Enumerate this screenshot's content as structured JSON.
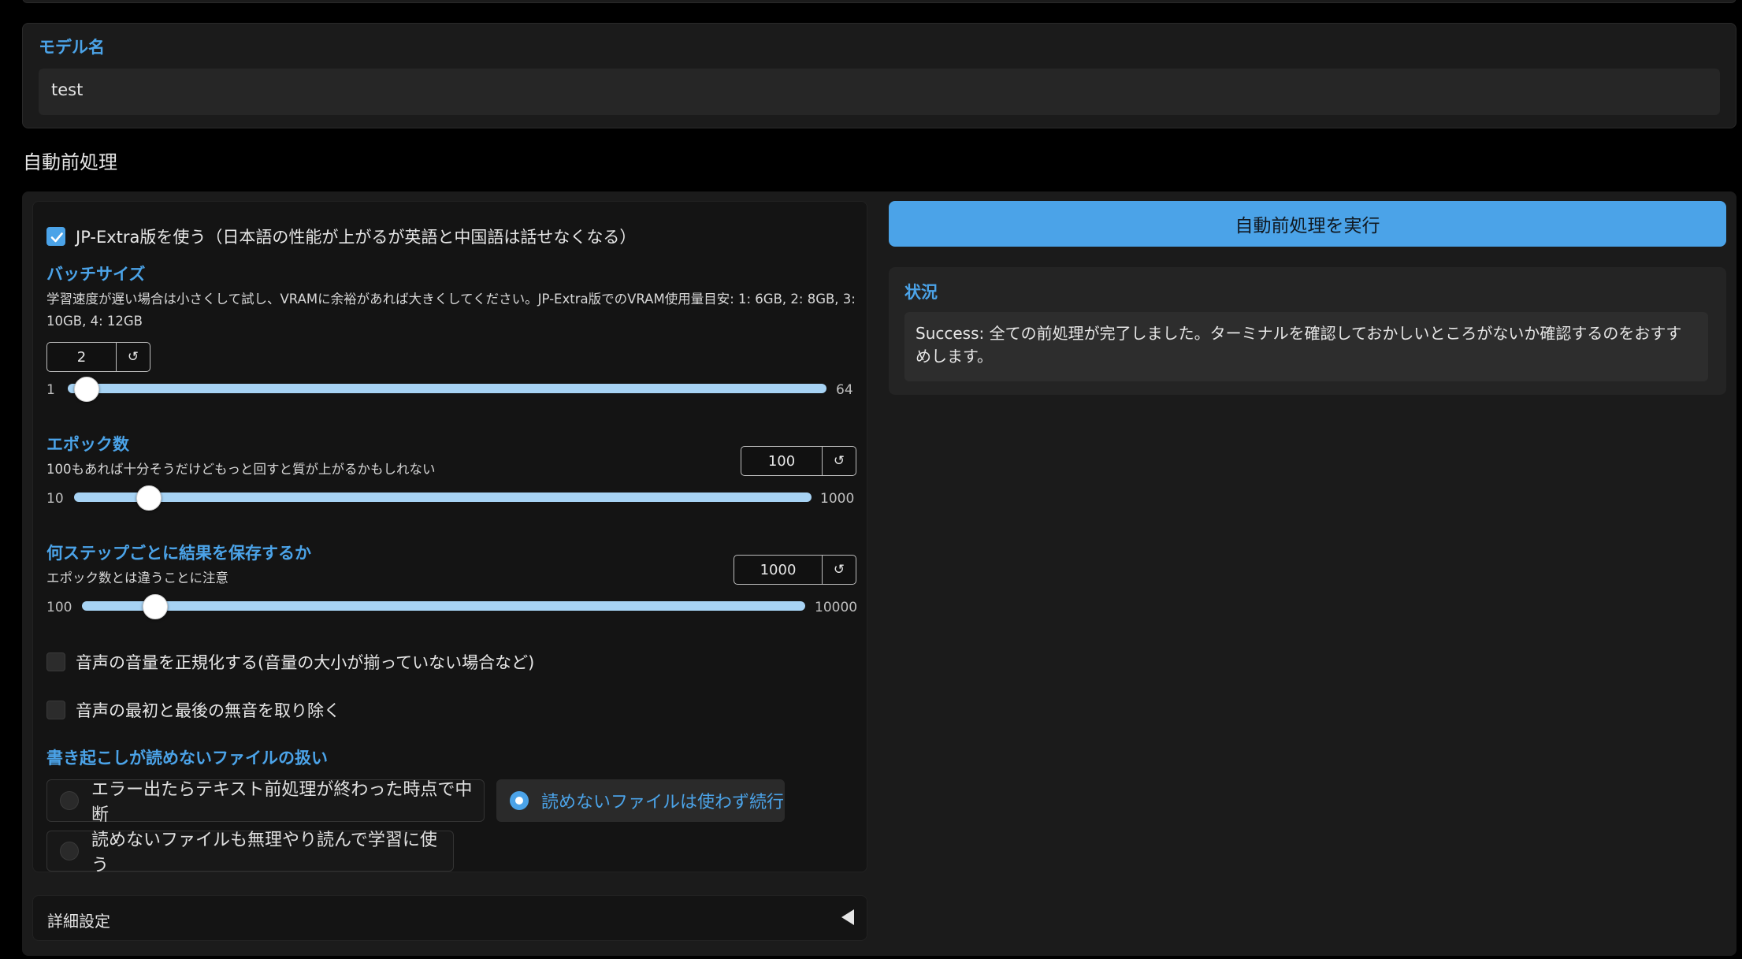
{
  "model_name": {
    "label": "モデル名",
    "value": "test"
  },
  "section_title": "自動前処理",
  "jp_extra": {
    "label": "JP-Extra版を使う（日本語の性能が上がるが英語と中国語は話せなくなる）",
    "checked": true
  },
  "batch_size": {
    "label": "バッチサイズ",
    "desc": "学習速度が遅い場合は小さくして試し、VRAMに余裕があれば大きくしてください。JP-Extra版でのVRAM使用量目安: 1: 6GB, 2: 8GB, 3: 10GB, 4: 12GB",
    "value": "2",
    "min": "1",
    "max": "64"
  },
  "epochs": {
    "label": "エポック数",
    "desc": "100もあれば十分そうだけどもっと回すと質が上がるかもしれない",
    "value": "100",
    "min": "10",
    "max": "1000"
  },
  "save_every": {
    "label": "何ステップごとに結果を保存するか",
    "desc": "エポック数とは違うことに注意",
    "value": "1000",
    "min": "100",
    "max": "10000"
  },
  "normalize": {
    "label": "音声の音量を正規化する(音量の大小が揃っていない場合など)",
    "checked": false
  },
  "trim": {
    "label": "音声の最初と最後の無音を取り除く",
    "checked": false
  },
  "unreadable": {
    "label": "書き起こしが読めないファイルの扱い",
    "options": [
      "エラー出たらテキスト前処理が終わった時点で中断",
      "読めないファイルは使わず続行",
      "読めないファイルも無理やり読んで学習に使う"
    ],
    "selected": "読めないファイルは使わず続行"
  },
  "advanced": {
    "label": "詳細設定"
  },
  "run_button": "自動前処理を実行",
  "status": {
    "label": "状況",
    "text": "Success: 全ての前処理が完了しました。ターミナルを確認しておかしいところがないか確認するのをおすすめします。"
  },
  "icons": {
    "reset": "reset-icon",
    "check": "check-icon",
    "collapse": "caret-left-icon"
  },
  "colors": {
    "accent": "#4ba3e8",
    "panel": "#1b1b1b",
    "background": "#000000"
  }
}
